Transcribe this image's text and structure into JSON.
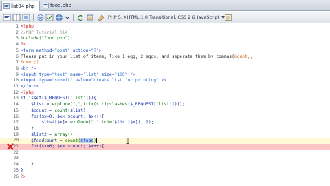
{
  "tabs": [
    {
      "label": "list04.php"
    },
    {
      "label": "food.php"
    }
  ],
  "toolbar": {
    "doctype_label": "PHP 5, XHTML 1.0 Transitional, CSS 2 & JavaScript"
  },
  "editor": {
    "lines": [
      {
        "num": "1"
      },
      {
        "num": "2"
      },
      {
        "num": "3"
      },
      {
        "num": "4"
      },
      {
        "num": "5"
      },
      {
        "num": "6"
      },
      {
        "num": "7"
      },
      {
        "num": "8"
      },
      {
        "num": "9"
      },
      {
        "num": "10"
      },
      {
        "num": "11"
      },
      {
        "num": "12"
      },
      {
        "num": "13"
      },
      {
        "num": "14"
      },
      {
        "num": "15"
      },
      {
        "num": "16"
      },
      {
        "num": "17"
      },
      {
        "num": "18"
      },
      {
        "num": "19"
      },
      {
        "num": "20"
      },
      {
        "num": "21"
      },
      {
        "num": "22"
      },
      {
        "num": "23"
      },
      {
        "num": "24"
      },
      {
        "num": "25"
      },
      {
        "num": "26"
      }
    ],
    "code": {
      "l1": "<?php",
      "l2": "//PHP Tutorial 014",
      "l3a": "include(",
      "l3b": "\"food.php\"",
      "l3c": ");",
      "l4": "?>",
      "l5a": "<form",
      "l5b": " method=",
      "l5c": "\"post\"",
      "l5d": " action=",
      "l5e": "\"?\"",
      "l5f": ">",
      "l6a": "Please put in your list of items, like 1 egg, 2 eggs, and seperate them by commas(",
      "l6b": "&quot;,",
      "l7": "&quot;).",
      "l8": "<br />",
      "l9a": "<input",
      "l9b": " type=",
      "l9c": "\"text\"",
      "l9d": " name=",
      "l9e": "\"list\"",
      "l9f": " size=",
      "l9g": "\"100\"",
      "l9h": " />",
      "l10a": "<input",
      "l10b": " type=",
      "l10c": "\"submit\"",
      "l10d": " value=",
      "l10e": "\"create list for printing\"",
      "l10f": " />",
      "l11": "</form>",
      "l12": "<?php",
      "l13a": "if(isset(",
      "l13b": "$_REQUEST",
      "l13c": "[",
      "l13d": "'list'",
      "l13e": "])){",
      "l14a": "    $list",
      "l14b": " = ",
      "l14c": "explode(",
      "l14d": "\",\"",
      "l14e": ",trim(stripslashes(",
      "l14f": "$_REQUEST",
      "l14g": "[",
      "l14h": "'list'",
      "l14i": "])));",
      "l15a": "    $count",
      "l15b": " = ",
      "l15c": "count(",
      "l15d": "$list",
      "l15e": ");",
      "l16a": "    for(",
      "l16b": "$x",
      "l16c": "=0; ",
      "l16d": "$x",
      "l16e": "< ",
      "l16f": "$count",
      "l16g": "; ",
      "l16h": "$x",
      "l16i": "++){",
      "l17a": "        $list",
      "l17b": "[",
      "l17c": "$x",
      "l17d": "]= ",
      "l17e": "explode(",
      "l17f": "\" \"",
      "l17g": ",trim(",
      "l17h": "$list",
      "l17i": "[",
      "l17j": "$x",
      "l17k": "]), 2);",
      "l18": "    }",
      "l19a": "    $list2",
      "l19b": " = ",
      "l19c": "array();",
      "l20a": "    $foodcount",
      "l20b": " = ",
      "l20c": "count(",
      "l20d": "$food",
      "l20e": ")",
      "l21a": "    for(",
      "l21b": "$x",
      "l21c": "=0; ",
      "l21d": "$x",
      "l21e": "< ",
      "l21f": "$count",
      "l21g": "; ",
      "l21h": "$x",
      "l21i": "++){",
      "l22": "",
      "l23": "",
      "l24": "    }",
      "l25": "}",
      "l26": "?>"
    }
  },
  "colors": {
    "error_line": "#fbc5c5",
    "cursor_line": "#fff9d6",
    "error_icon": "#d42020"
  },
  "status": {
    "error_line_number": "21",
    "cursor_line_number": "20"
  }
}
